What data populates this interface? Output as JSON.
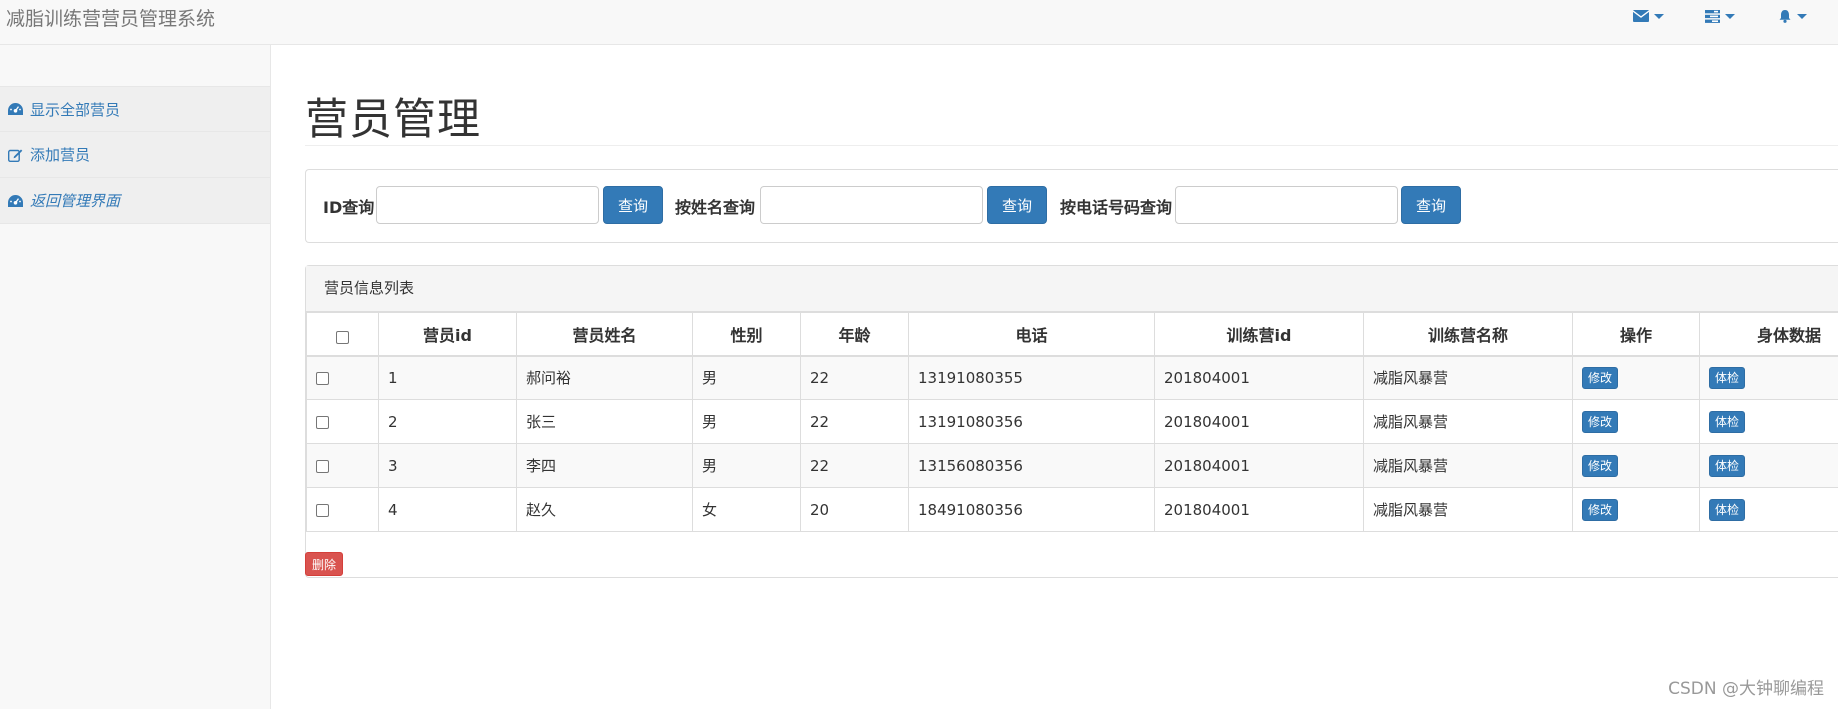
{
  "app": {
    "title": "减脂训练营营员管理系统"
  },
  "topbar": {
    "icons": [
      "envelope-icon",
      "tasks-icon",
      "bell-icon"
    ]
  },
  "sidebar": {
    "items": [
      {
        "label": "显示全部营员",
        "icon": "dashboard-icon"
      },
      {
        "label": "添加营员",
        "icon": "edit-icon"
      },
      {
        "label": "返回管理界面",
        "icon": "dashboard-icon"
      }
    ]
  },
  "page": {
    "title": "营员管理"
  },
  "search": {
    "id_label": "ID查询",
    "id_value": "",
    "name_label": "按姓名查询",
    "name_value": "",
    "phone_label": "按电话号码查询",
    "phone_value": "",
    "button_label": "查询"
  },
  "list": {
    "heading": "营员信息列表",
    "columns": [
      "营员id",
      "营员姓名",
      "性别",
      "年龄",
      "电话",
      "训练营id",
      "训练营名称",
      "操作",
      "身体数据"
    ],
    "rows": [
      {
        "id": "1",
        "name": "郝问裕",
        "gender": "男",
        "age": "22",
        "phone": "13191080355",
        "camp_id": "201804001",
        "camp_name": "减脂风暴营",
        "edit": "修改",
        "check": "体检"
      },
      {
        "id": "2",
        "name": "张三",
        "gender": "男",
        "age": "22",
        "phone": "13191080356",
        "camp_id": "201804001",
        "camp_name": "减脂风暴营",
        "edit": "修改",
        "check": "体检"
      },
      {
        "id": "3",
        "name": "李四",
        "gender": "男",
        "age": "22",
        "phone": "13156080356",
        "camp_id": "201804001",
        "camp_name": "减脂风暴营",
        "edit": "修改",
        "check": "体检"
      },
      {
        "id": "4",
        "name": "赵久",
        "gender": "女",
        "age": "20",
        "phone": "18491080356",
        "camp_id": "201804001",
        "camp_name": "减脂风暴营",
        "edit": "修改",
        "check": "体检"
      }
    ],
    "delete_label": "删除"
  },
  "watermark": "CSDN @大钟聊编程",
  "colors": {
    "primary": "#337ab7",
    "danger": "#d9534f",
    "navbar": "#f8f8f8"
  }
}
